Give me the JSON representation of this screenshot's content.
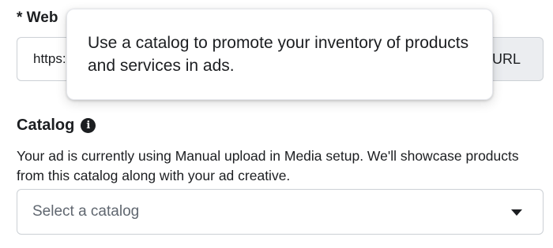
{
  "website": {
    "label": "* Web",
    "url_value": "https:",
    "suffix": "URL"
  },
  "tooltip": {
    "text": "Use a catalog to promote your inventory of products and services in ads."
  },
  "catalog": {
    "title": "Catalog",
    "info_icon": "info-icon",
    "info_glyph": "i",
    "description": "Your ad is currently using Manual upload in Media setup. We'll showcase products from this catalog along with your ad creative.",
    "select_placeholder": "Select a catalog",
    "dropdown_icon": "chevron-down-icon"
  }
}
